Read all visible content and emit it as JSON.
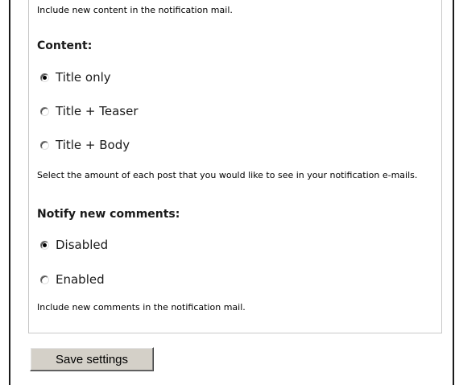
{
  "form": {
    "include_content_desc": "Include new content in the notification mail.",
    "content": {
      "heading": "Content:",
      "options": [
        {
          "label": "Title only",
          "checked": true
        },
        {
          "label": "Title + Teaser",
          "checked": false
        },
        {
          "label": "Title + Body",
          "checked": false
        }
      ],
      "desc": "Select the amount of each post that you would like to see in your notification e-mails."
    },
    "notify_comments": {
      "heading": "Notify new comments:",
      "options": [
        {
          "label": "Disabled",
          "checked": true
        },
        {
          "label": "Enabled",
          "checked": false
        }
      ],
      "desc": "Include new comments in the notification mail."
    },
    "save_label": "Save settings"
  }
}
